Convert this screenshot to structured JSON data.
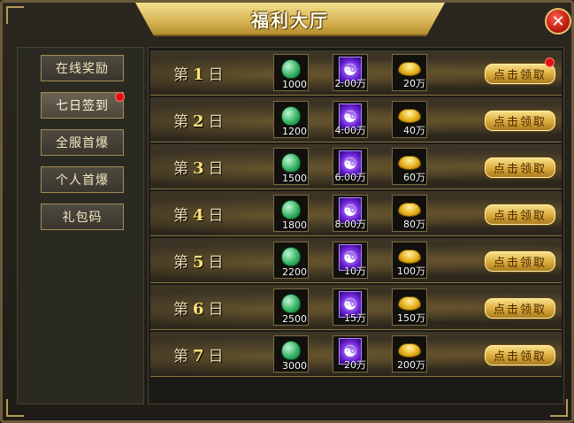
{
  "window": {
    "title": "福利大厅",
    "close_symbol": "✕"
  },
  "sidebar": {
    "items": [
      {
        "label": "在线奖励",
        "badge": false
      },
      {
        "label": "七日签到",
        "badge": true
      },
      {
        "label": "全服首爆",
        "badge": false
      },
      {
        "label": "个人首爆",
        "badge": false
      },
      {
        "label": "礼包码",
        "badge": false
      }
    ]
  },
  "rewards": {
    "day_prefix": "第",
    "day_suffix": "日",
    "claim_label": "点击领取",
    "rows": [
      {
        "day": "1",
        "items": [
          "1000",
          "2.00万",
          "20万"
        ],
        "badge": true
      },
      {
        "day": "2",
        "items": [
          "1200",
          "4.00万",
          "40万"
        ],
        "badge": false
      },
      {
        "day": "3",
        "items": [
          "1500",
          "6.00万",
          "60万"
        ],
        "badge": false
      },
      {
        "day": "4",
        "items": [
          "1800",
          "8.00万",
          "80万"
        ],
        "badge": false
      },
      {
        "day": "5",
        "items": [
          "2200",
          "10万",
          "100万"
        ],
        "badge": false
      },
      {
        "day": "6",
        "items": [
          "2500",
          "15万",
          "150万"
        ],
        "badge": false
      },
      {
        "day": "7",
        "items": [
          "3000",
          "20万",
          "200万"
        ],
        "badge": false
      }
    ],
    "item_icons": [
      "jade-icon",
      "taiji-orb-icon",
      "gold-ingot-icon"
    ]
  },
  "colors": {
    "accent_gold": "#d7b454",
    "badge_red": "#e01010",
    "close_red": "#b3140b"
  }
}
